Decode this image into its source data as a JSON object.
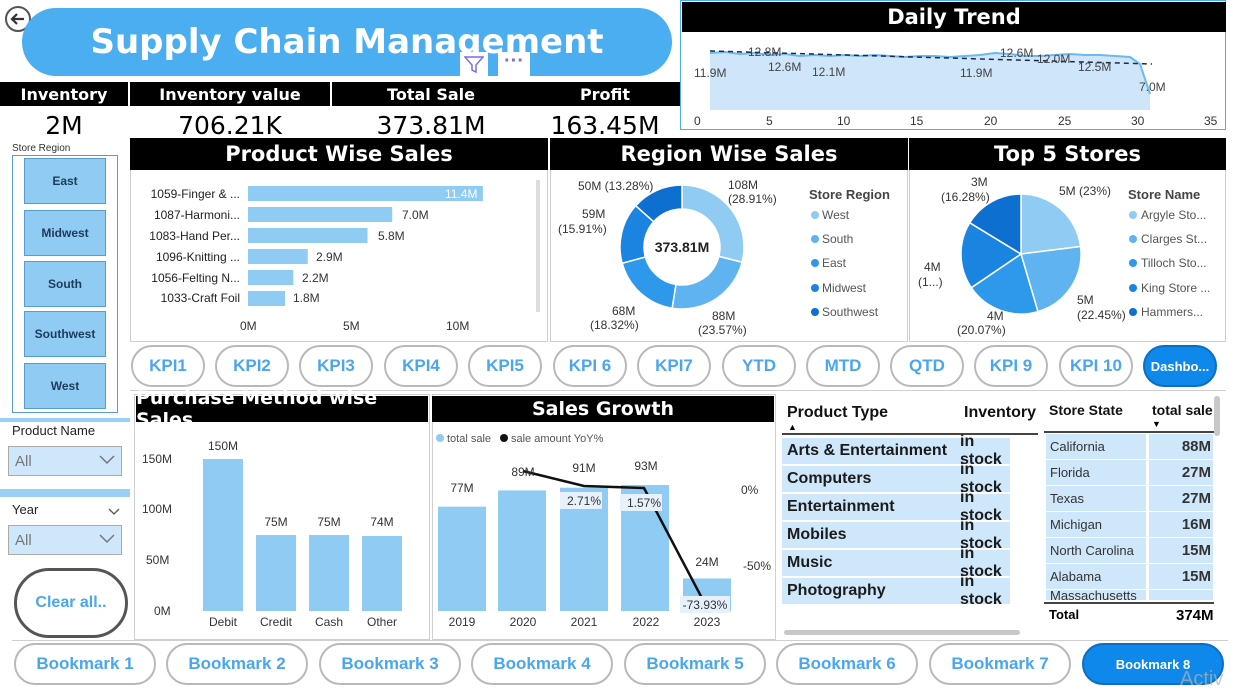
{
  "header": {
    "title": "Supply Chain Management"
  },
  "kpis": [
    {
      "label": "Inventory",
      "value": "2M"
    },
    {
      "label": "Inventory value",
      "value": "706.21K"
    },
    {
      "label": "Total Sale",
      "value": "373.81M"
    },
    {
      "label": "Profit",
      "value": "163.45M"
    }
  ],
  "region_filter": {
    "label": "Store Region",
    "items": [
      "East",
      "Midwest",
      "South",
      "Southwest",
      "West"
    ]
  },
  "product_filter": {
    "label": "Product Name",
    "value": "All"
  },
  "year_filter": {
    "label": "Year",
    "value": "All"
  },
  "clear_label": "Clear all..",
  "daily_trend": {
    "title": "Daily Trend",
    "x_ticks": [
      "0",
      "5",
      "10",
      "15",
      "20",
      "25",
      "30",
      "35"
    ],
    "labels": [
      "11.9M",
      "12.8M",
      "12.6M",
      "12.1M",
      "11.9M",
      "12.6M",
      "12.0M",
      "12.5M",
      "7.0M"
    ]
  },
  "product_sales": {
    "title": "Product Wise Sales",
    "x_ticks": [
      "0M",
      "5M",
      "10M"
    ],
    "items": [
      {
        "name": "1059-Finger & ...",
        "label": "11.4M"
      },
      {
        "name": "1087-Harmoni...",
        "label": "7.0M"
      },
      {
        "name": "1083-Hand Per...",
        "label": "5.8M"
      },
      {
        "name": "1096-Knitting ...",
        "label": "2.9M"
      },
      {
        "name": "1056-Felting N...",
        "label": "2.2M"
      },
      {
        "name": "1033-Craft Foil",
        "label": "1.8M"
      }
    ]
  },
  "region_sales": {
    "title": "Region Wise Sales",
    "center": "373.81M",
    "legend_title": "Store Region",
    "legend": [
      "West",
      "South",
      "East",
      "Midwest",
      "Southwest"
    ],
    "labels": [
      {
        "v": "108M",
        "p": "(28.91%)"
      },
      {
        "v": "88M",
        "p": "(23.57%)"
      },
      {
        "v": "68M",
        "p": "(18.32%)"
      },
      {
        "v": "59M",
        "p": "(15.91%)"
      },
      {
        "v": "50M (13.28%)",
        "p": ""
      }
    ]
  },
  "top_stores": {
    "title": "Top 5 Stores",
    "legend_title": "Store Name",
    "legend": [
      "Argyle Sto...",
      "Clarges St...",
      "Tilloch Sto...",
      "King Store ...",
      "Hammers..."
    ],
    "labels": [
      {
        "v": "5M (23%)",
        "p": ""
      },
      {
        "v": "5M",
        "p": "(22.45%)"
      },
      {
        "v": "4M",
        "p": "(20.07%)"
      },
      {
        "v": "4M",
        "p": "(1...)"
      },
      {
        "v": "3M",
        "p": "(16.28%)"
      }
    ]
  },
  "kpi_tabs": [
    "KPI1",
    "KPI2",
    "KPI3",
    "KPI4",
    "KPI5",
    "KPI 6",
    "KPI7",
    "YTD",
    "MTD",
    "QTD",
    "KPI 9",
    "KPI 10",
    "Dashbo..."
  ],
  "purchase_method": {
    "title": "Purchase Method wise Sales",
    "y_ticks": [
      "150M",
      "100M",
      "50M",
      "0M"
    ],
    "categories": [
      "Debit",
      "Credit",
      "Cash",
      "Other"
    ],
    "labels": [
      "150M",
      "75M",
      "75M",
      "74M"
    ]
  },
  "sales_growth": {
    "title": "Sales Growth",
    "legend": [
      "total sale",
      "sale amount YoY%"
    ],
    "categories": [
      "2019",
      "2020",
      "2021",
      "2022",
      "2023"
    ],
    "bar_labels": [
      "77M",
      "89M",
      "91M",
      "93M",
      "24M"
    ],
    "line_labels": [
      "2.71%",
      "1.57%",
      "-73.93%"
    ],
    "y2_ticks": [
      "0%",
      "-50%"
    ]
  },
  "product_type_table": {
    "headers": [
      "Product Type",
      "Inventory"
    ],
    "rows": [
      [
        "Arts & Entertainment",
        "in stock"
      ],
      [
        "Computers",
        "in stock"
      ],
      [
        "Entertainment",
        "in stock"
      ],
      [
        "Mobiles",
        "in stock"
      ],
      [
        "Music",
        "in stock"
      ],
      [
        "Photography",
        "in stock"
      ]
    ]
  },
  "store_state_table": {
    "headers": [
      "Store State",
      "total sale"
    ],
    "rows": [
      [
        "California",
        "88M"
      ],
      [
        "Florida",
        "27M"
      ],
      [
        "Texas",
        "27M"
      ],
      [
        "Michigan",
        "16M"
      ],
      [
        "North Carolina",
        "15M"
      ],
      [
        "Alabama",
        "15M"
      ],
      [
        "Massachusetts",
        ""
      ]
    ],
    "total_label": "Total",
    "total_value": "374M"
  },
  "bookmarks": [
    "Bookmark 1",
    "Bookmark 2",
    "Bookmark 3",
    "Bookmark 4",
    "Bookmark 5",
    "Bookmark 6",
    "Bookmark 7",
    "Bookmark 8"
  ],
  "watermark": "Activ",
  "chart_data": [
    {
      "type": "line",
      "title": "Daily Trend",
      "x": [
        1,
        2,
        3,
        4,
        5,
        6,
        7,
        8,
        9,
        10,
        11,
        12,
        13,
        14,
        15,
        16,
        17,
        18,
        19,
        20,
        21,
        22,
        23,
        24,
        25,
        26,
        27,
        28,
        29,
        30,
        31
      ],
      "values": [
        11.9,
        12.8,
        12.3,
        12.6,
        12.4,
        12.3,
        12.5,
        12.1,
        12.3,
        12.4,
        12.2,
        12.3,
        12.1,
        12.2,
        12.0,
        12.1,
        11.9,
        12.2,
        12.3,
        12.6,
        12.4,
        12.0,
        12.1,
        12.4,
        12.5,
        12.2,
        12.3,
        12.2,
        12.0,
        11.5,
        7.0
      ],
      "xlim": [
        0,
        35
      ]
    },
    {
      "type": "bar",
      "title": "Product Wise Sales",
      "categories": [
        "1059-Finger & ...",
        "1087-Harmoni...",
        "1083-Hand Per...",
        "1096-Knitting ...",
        "1056-Felting N...",
        "1033-Craft Foil"
      ],
      "values": [
        11.4,
        7.0,
        5.8,
        2.9,
        2.2,
        1.8
      ],
      "xlim": [
        0,
        12
      ]
    },
    {
      "type": "pie",
      "title": "Region Wise Sales",
      "categories": [
        "West",
        "South",
        "East",
        "Midwest",
        "Southwest"
      ],
      "values": [
        108,
        88,
        68,
        59,
        50
      ]
    },
    {
      "type": "pie",
      "title": "Top 5 Stores",
      "categories": [
        "Argyle Sto...",
        "Clarges St...",
        "Tilloch Sto...",
        "King Store ...",
        "Hammers..."
      ],
      "values": [
        23,
        22.45,
        20.07,
        18.2,
        16.28
      ]
    },
    {
      "type": "bar",
      "title": "Purchase Method wise Sales",
      "categories": [
        "Debit",
        "Credit",
        "Cash",
        "Other"
      ],
      "values": [
        150,
        75,
        75,
        74
      ],
      "ylim": [
        0,
        160
      ]
    },
    {
      "type": "bar",
      "title": "Sales Growth",
      "categories": [
        "2019",
        "2020",
        "2021",
        "2022",
        "2023"
      ],
      "series": [
        {
          "name": "total sale",
          "values": [
            77,
            89,
            91,
            93,
            24
          ]
        },
        {
          "name": "sale amount YoY%",
          "values": [
            null,
            15.6,
            2.71,
            1.57,
            -73.93
          ]
        }
      ]
    }
  ]
}
